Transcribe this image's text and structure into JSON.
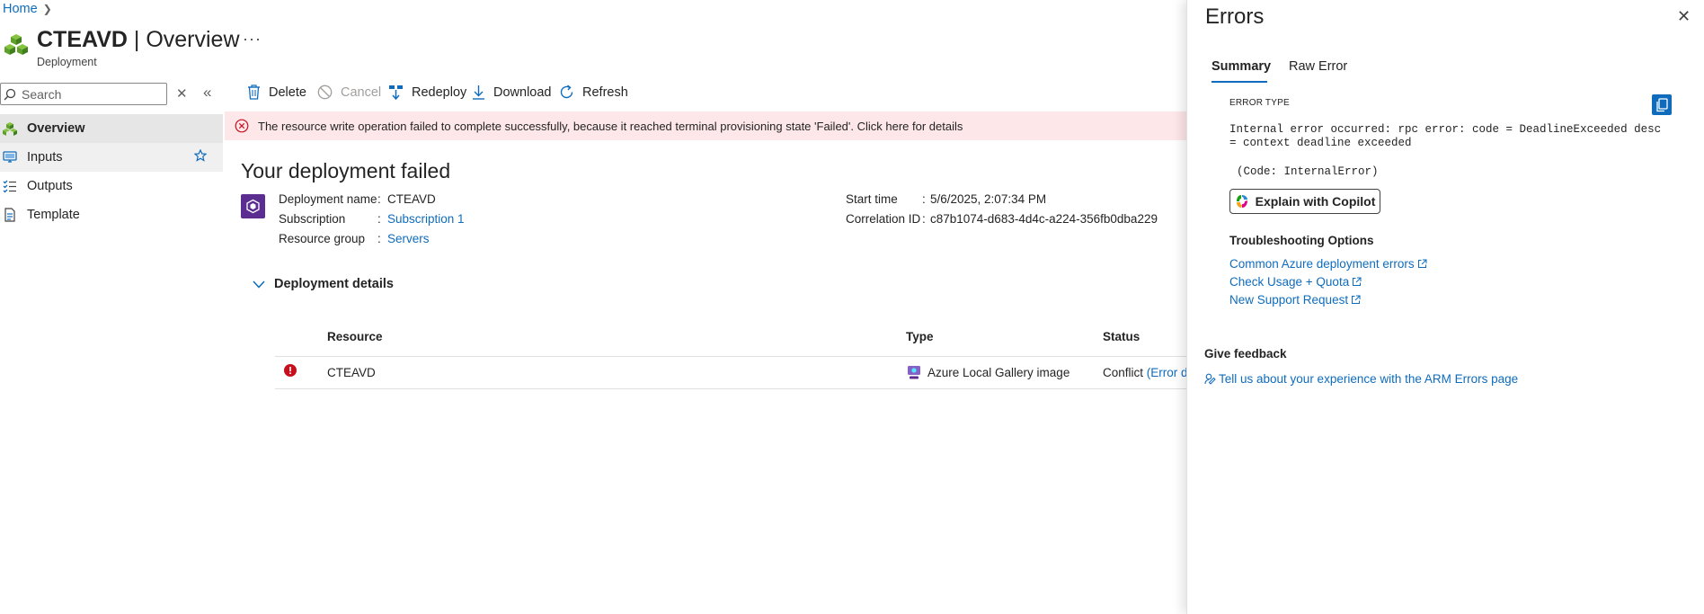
{
  "breadcrumb": {
    "home": "Home"
  },
  "header": {
    "resource_name": "CTEAVD",
    "separator": " | ",
    "page": "Overview",
    "subtitle": "Deployment",
    "more": "···"
  },
  "nav": {
    "search_placeholder": "Search",
    "items": [
      {
        "label": "Overview",
        "icon": "overview-icon"
      },
      {
        "label": "Inputs",
        "icon": "inputs-icon"
      },
      {
        "label": "Outputs",
        "icon": "outputs-icon"
      },
      {
        "label": "Template",
        "icon": "template-icon"
      }
    ]
  },
  "toolbar": {
    "delete": "Delete",
    "cancel": "Cancel",
    "redeploy": "Redeploy",
    "download": "Download",
    "refresh": "Refresh"
  },
  "banner": {
    "text": "The resource write operation failed to complete successfully, because it reached terminal provisioning state 'Failed'. Click here for details"
  },
  "deployment": {
    "title": "Your deployment failed",
    "name_label": "Deployment name",
    "name": "CTEAVD",
    "subscription_label": "Subscription",
    "subscription": "Subscription 1",
    "resource_group_label": "Resource group",
    "resource_group": "Servers",
    "start_time_label": "Start time",
    "start_time": "5/6/2025, 2:07:34 PM",
    "correlation_label": "Correlation ID",
    "correlation_id": "c87b1074-d683-4d4c-a224-356fb0dba229",
    "colon": ":"
  },
  "details": {
    "toggle_label": "Deployment details",
    "columns": {
      "resource": "Resource",
      "type": "Type",
      "status": "Status"
    },
    "rows": [
      {
        "resource": "CTEAVD",
        "type": "Azure Local Gallery image",
        "status": "Conflict",
        "status_link": "(Error d"
      }
    ]
  },
  "errors_panel": {
    "title": "Errors",
    "tabs": {
      "summary": "Summary",
      "raw": "Raw Error"
    },
    "error_type_label": "ERROR TYPE",
    "message": "Internal error occurred: rpc error: code = DeadlineExceeded desc = context deadline exceeded",
    "code": "(Code: InternalError)",
    "copilot_button": "Explain with Copilot",
    "troubleshooting_title": "Troubleshooting Options",
    "links": [
      "Common Azure deployment errors",
      "Check Usage + Quota",
      "New Support Request"
    ],
    "feedback_title": "Give feedback",
    "feedback_link": "Tell us about your experience with the ARM Errors page"
  },
  "colors": {
    "accent": "#0f6cbd",
    "error": "#c50f1f",
    "banner_bg": "#fde7e9",
    "deploy_icon": "#5c2d91"
  }
}
